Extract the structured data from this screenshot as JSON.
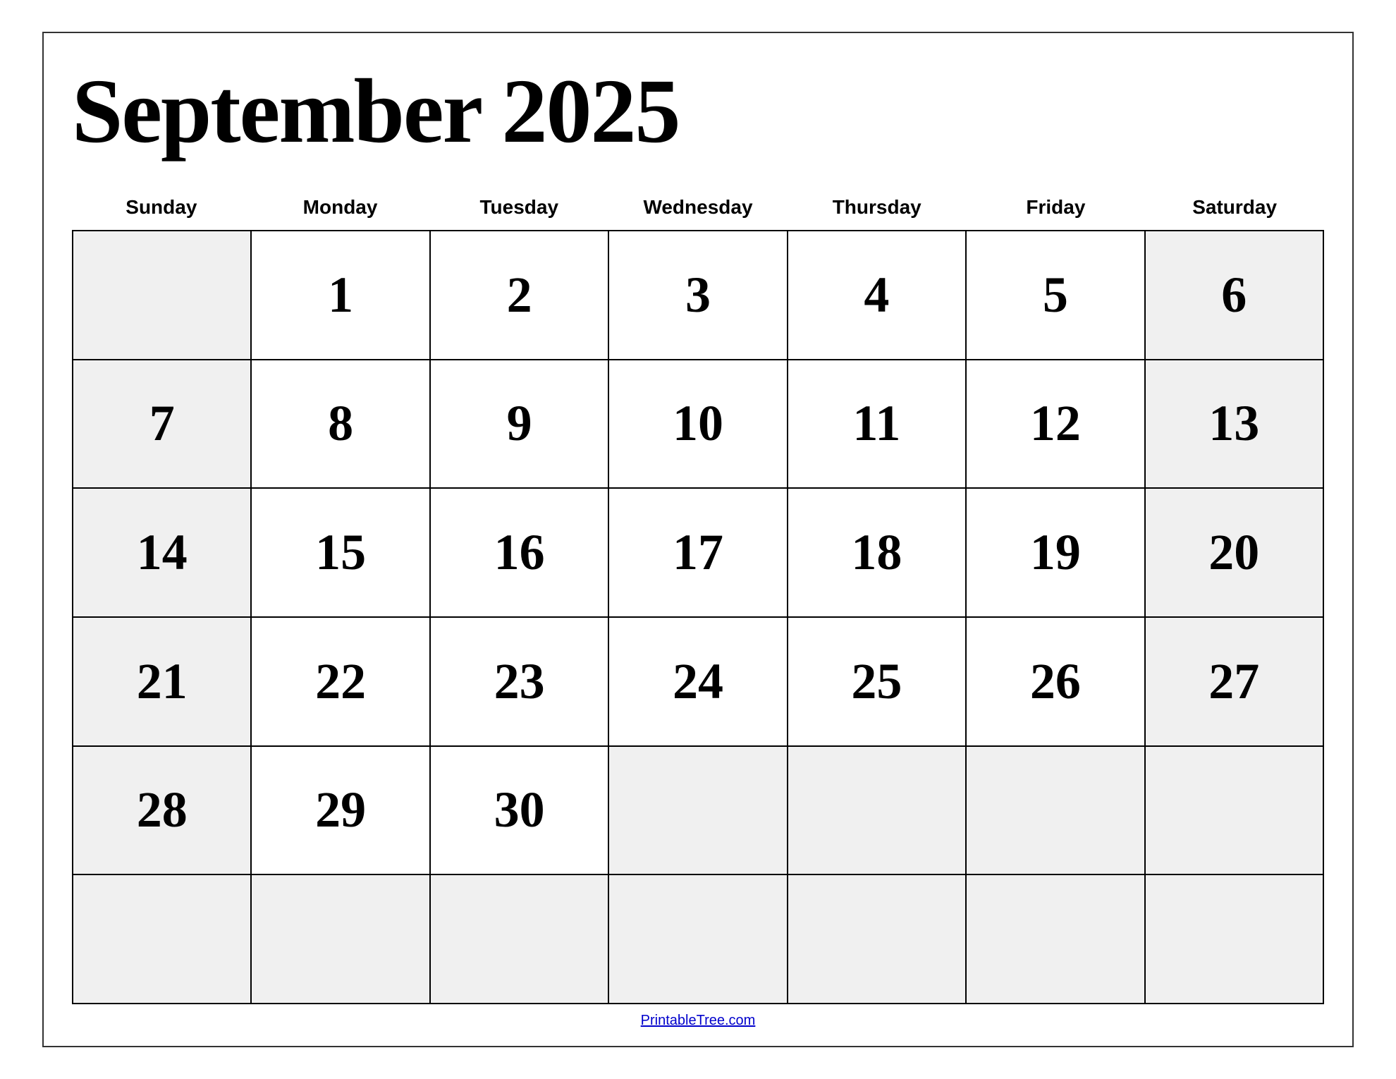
{
  "title": "September 2025",
  "days": [
    "Sunday",
    "Monday",
    "Tuesday",
    "Wednesday",
    "Thursday",
    "Friday",
    "Saturday"
  ],
  "weeks": [
    [
      {
        "date": null,
        "dayType": "sunday"
      },
      {
        "date": "1",
        "dayType": "weekday"
      },
      {
        "date": "2",
        "dayType": "weekday"
      },
      {
        "date": "3",
        "dayType": "weekday"
      },
      {
        "date": "4",
        "dayType": "weekday"
      },
      {
        "date": "5",
        "dayType": "weekday"
      },
      {
        "date": "6",
        "dayType": "saturday"
      }
    ],
    [
      {
        "date": "7",
        "dayType": "sunday"
      },
      {
        "date": "8",
        "dayType": "weekday"
      },
      {
        "date": "9",
        "dayType": "weekday"
      },
      {
        "date": "10",
        "dayType": "weekday"
      },
      {
        "date": "11",
        "dayType": "weekday"
      },
      {
        "date": "12",
        "dayType": "weekday"
      },
      {
        "date": "13",
        "dayType": "saturday"
      }
    ],
    [
      {
        "date": "14",
        "dayType": "sunday"
      },
      {
        "date": "15",
        "dayType": "weekday"
      },
      {
        "date": "16",
        "dayType": "weekday"
      },
      {
        "date": "17",
        "dayType": "weekday"
      },
      {
        "date": "18",
        "dayType": "weekday"
      },
      {
        "date": "19",
        "dayType": "weekday"
      },
      {
        "date": "20",
        "dayType": "saturday"
      }
    ],
    [
      {
        "date": "21",
        "dayType": "sunday"
      },
      {
        "date": "22",
        "dayType": "weekday"
      },
      {
        "date": "23",
        "dayType": "weekday"
      },
      {
        "date": "24",
        "dayType": "weekday"
      },
      {
        "date": "25",
        "dayType": "weekday"
      },
      {
        "date": "26",
        "dayType": "weekday"
      },
      {
        "date": "27",
        "dayType": "saturday"
      }
    ],
    [
      {
        "date": "28",
        "dayType": "sunday"
      },
      {
        "date": "29",
        "dayType": "weekday"
      },
      {
        "date": "30",
        "dayType": "weekday"
      },
      {
        "date": null,
        "dayType": "weekday"
      },
      {
        "date": null,
        "dayType": "weekday"
      },
      {
        "date": null,
        "dayType": "weekday"
      },
      {
        "date": null,
        "dayType": "saturday"
      }
    ],
    [
      {
        "date": null,
        "dayType": "sunday"
      },
      {
        "date": null,
        "dayType": "weekday"
      },
      {
        "date": null,
        "dayType": "weekday"
      },
      {
        "date": null,
        "dayType": "weekday"
      },
      {
        "date": null,
        "dayType": "weekday"
      },
      {
        "date": null,
        "dayType": "weekday"
      },
      {
        "date": null,
        "dayType": "saturday"
      }
    ]
  ],
  "footer": {
    "link_text": "PrintableTree.com",
    "link_url": "#"
  }
}
